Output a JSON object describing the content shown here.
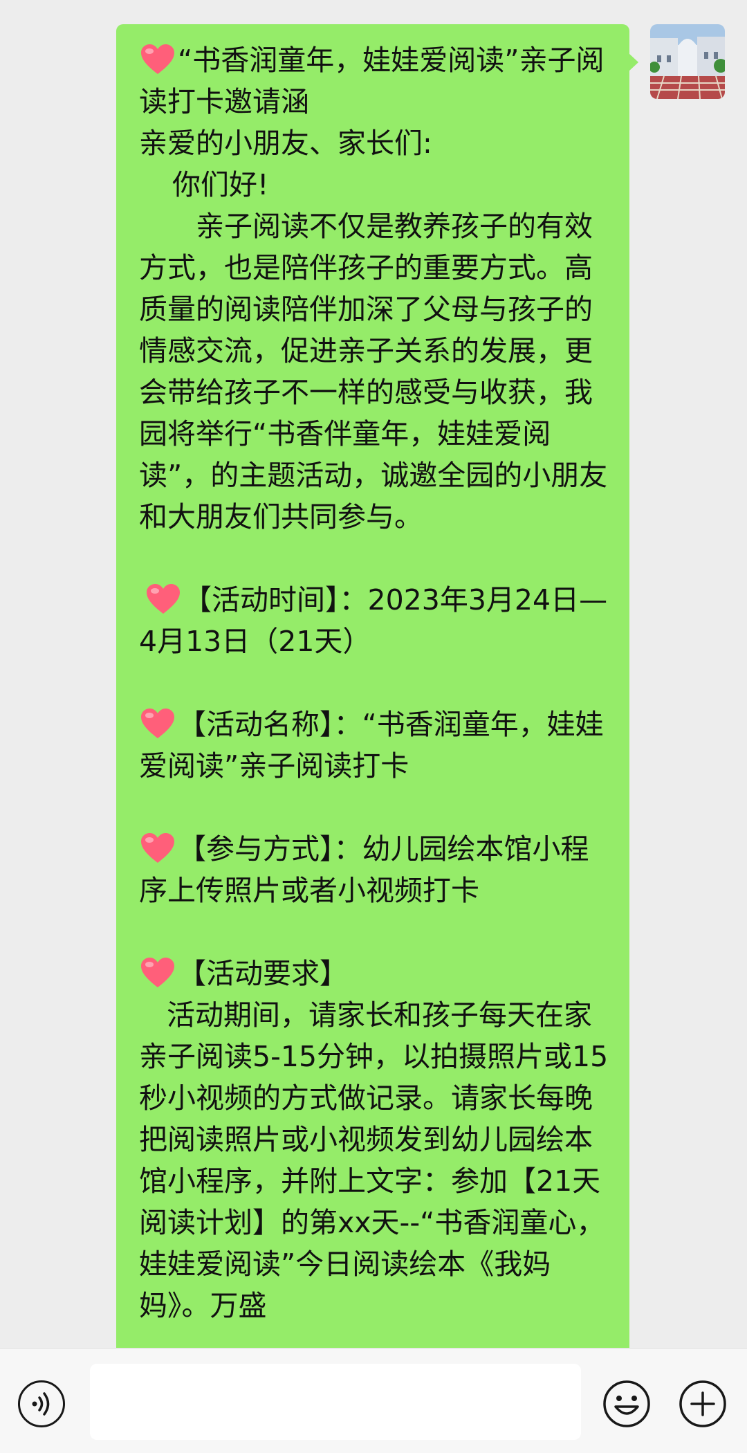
{
  "message": {
    "title": "“书香润童年，娃娃爱阅读”亲子阅读打卡邀请涵",
    "greeting": "亲爱的小朋友、家长们:",
    "hello": "你们好!",
    "intro": "亲子阅读不仅是教养孩子的有效方式，也是陪伴孩子的重要方式。高质量的阅读陪伴加深了父母与孩子的情感交流，促进亲子关系的发展，更会带给孩子不一样的感受与收获，我园将举行“书香伴童年，娃娃爱阅读”，的主题活动，诚邀全园的小朋友和大朋友们共同参与。",
    "time": "【活动时间】：2023年3月24日—4月13日（21天）",
    "name": "【活动名称】：“书香润童年，娃娃爱阅读”亲子阅读打卡",
    "method": "【参与方式】：幼儿园绘本馆小程序上传照片或者小视频打卡",
    "req_title": "【活动要求】",
    "req_body": "活动期间，请家长和孩子每天在家亲子阅读5-15分钟，以拍摄照片或15秒小视频的方式做记录。请家长每晚把阅读照片或小视频发到幼儿园绘本馆小程序，并附上文字：参加【21天阅读计划】的第xx天--“书香润童心，娃娃爱阅读”今日阅读绘本《我妈妈》。万盛"
  },
  "icons": {
    "heart": "heart-emoji",
    "voice": "voice-icon",
    "emoji": "emoji-icon",
    "plus": "plus-icon",
    "avatar": "avatar-image"
  },
  "colors": {
    "bubble": "#95ec69",
    "background": "#ededed",
    "heart": "#ff5f7a"
  }
}
